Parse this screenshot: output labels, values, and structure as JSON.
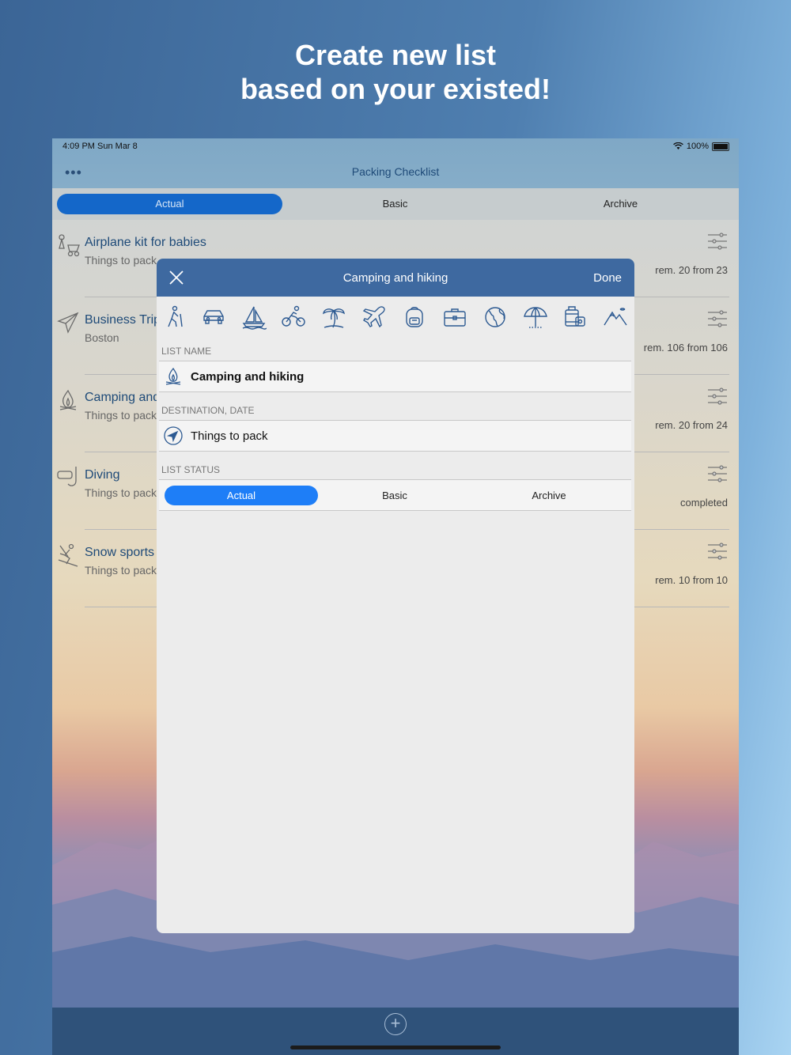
{
  "headline": {
    "line1": "Create new list",
    "line2": "based on your existed!"
  },
  "statusbar": {
    "time": "4:09 PM  Sun Mar 8",
    "battery": "100%"
  },
  "navbar": {
    "title": "Packing Checklist",
    "menu_icon": "more-dots-icon"
  },
  "top_tabs": [
    {
      "label": "Actual",
      "active": true
    },
    {
      "label": "Basic",
      "active": false
    },
    {
      "label": "Archive",
      "active": false
    }
  ],
  "lists": [
    {
      "title": "Airplane kit for babies",
      "subtitle": "Things to pack",
      "status": "rem. 20 from 23",
      "icon": "baby-stroller-icon"
    },
    {
      "title": "Business Trip",
      "subtitle": "Boston",
      "status": "rem. 106 from 106",
      "icon": "airplane-icon"
    },
    {
      "title": "Camping and",
      "subtitle": "Things to pack",
      "status": "rem. 20 from 24",
      "icon": "campfire-icon"
    },
    {
      "title": "Diving",
      "subtitle": "Things to pack",
      "status": "completed",
      "icon": "snorkel-icon"
    },
    {
      "title": "Snow sports",
      "subtitle": "Things to pack",
      "status": "rem. 10 from 10",
      "icon": "skier-icon"
    }
  ],
  "modal": {
    "title": "Camping and hiking",
    "done_label": "Done",
    "icons": [
      "hiker-icon",
      "car-icon",
      "sailboat-icon",
      "cyclist-icon",
      "palm-tree-icon",
      "airplane-icon",
      "backpack-icon",
      "briefcase-icon",
      "globe-icon",
      "beach-umbrella-icon",
      "luggage-icon",
      "mountains-icon"
    ],
    "list_name_label": "LIST NAME",
    "list_name_value": "Camping and hiking",
    "destination_label": "DESTINATION, DATE",
    "destination_value": "Things to pack",
    "status_label": "LIST STATUS",
    "status_options": [
      {
        "label": "Actual",
        "active": true
      },
      {
        "label": "Basic",
        "active": false
      },
      {
        "label": "Archive",
        "active": false
      }
    ]
  },
  "colors": {
    "accent": "#1e7ef7",
    "modal_header": "#3e69a0",
    "list_title": "#1e4a78"
  }
}
